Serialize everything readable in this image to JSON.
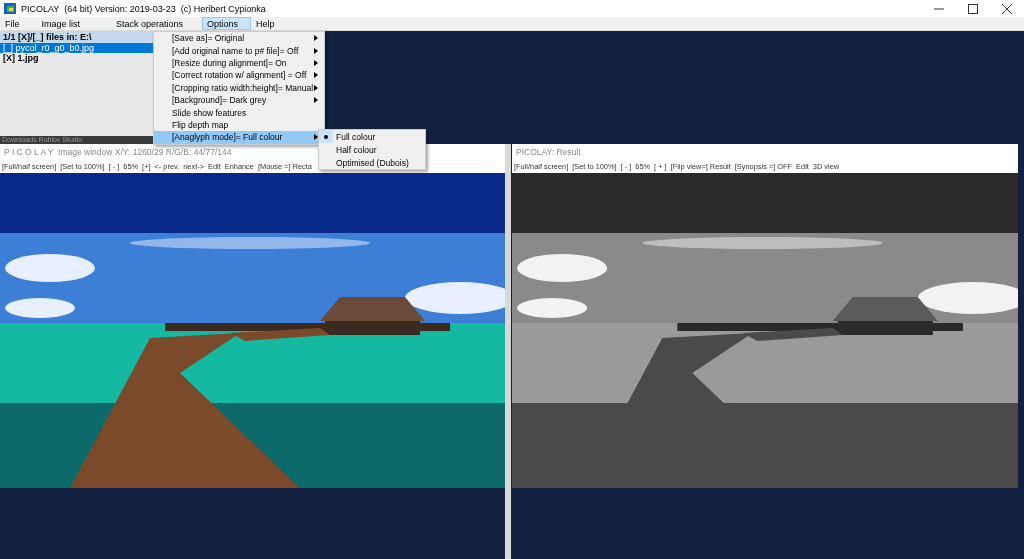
{
  "window": {
    "title": "PICOLAY  (64 bit) Version: 2019-03-23  (c) Heribert Cypionka"
  },
  "menu": [
    {
      "label": "File",
      "selected": false
    },
    {
      "label": "Image list",
      "selected": false
    },
    {
      "label": "Stack operations",
      "selected": false
    },
    {
      "label": "Options",
      "selected": true
    },
    {
      "label": "Help",
      "selected": false
    }
  ],
  "file_list": {
    "header": "1/1 [X]/[_] files in: E:\\",
    "items": [
      {
        "label": "[_] pycol_r0_g0_b0.jpg",
        "selected": true
      },
      {
        "label": "[X] 1.jpg",
        "selected": false
      }
    ]
  },
  "options_menu": {
    "items": [
      {
        "label": "[Save as]= Original",
        "has_submenu": true,
        "selected": false
      },
      {
        "label": "[Add original name to p# file]= Off",
        "has_submenu": true,
        "selected": false
      },
      {
        "label": "[Resize during alignment]= On",
        "has_submenu": true,
        "selected": false
      },
      {
        "label": "[Correct rotation  w/ alignment] = Off",
        "has_submenu": true,
        "selected": false
      },
      {
        "label": "[Cropping ratio width:height]= Manual",
        "has_submenu": true,
        "selected": false
      },
      {
        "label": "[Background]= Dark grey",
        "has_submenu": true,
        "selected": false
      },
      {
        "label": "Slide show features",
        "has_submenu": false,
        "selected": false
      },
      {
        "label": "Flip depth map",
        "has_submenu": false,
        "selected": false
      },
      {
        "label": "[Anaglyph mode]= Full colour",
        "has_submenu": true,
        "selected": true
      }
    ]
  },
  "submenu": {
    "items": [
      {
        "label": "Full colour",
        "checked": true
      },
      {
        "label": "Half colour",
        "checked": false
      },
      {
        "label": "Optimised (Dubois)",
        "checked": false
      }
    ]
  },
  "background_window": {
    "title": "Downloads  Roblox Studio"
  },
  "image_windows": [
    {
      "title": "P I C O L A Y  Image window X/Y: 1260/29 R/G/B: 44/77/144",
      "toolbar": [
        "[Full/half screen]",
        "[Set to 100%]",
        "[ - ]",
        "65%",
        "[+]",
        "<- prev.",
        "next->",
        "Edit",
        "Enhance",
        "[Mouse =] Recta"
      ],
      "picture": {
        "kind": "picture",
        "greyscale": false
      }
    },
    {
      "title": "PICOLAY: Result",
      "toolbar": [
        "[Full/half screen]",
        "[Set to 100%]",
        "[ - ]",
        "65%",
        "[ + ]",
        "[Flip view=] Result",
        "[Synopsis =] OFF",
        "Edit",
        "3D view"
      ],
      "picture": {
        "kind": "picture",
        "greyscale": true
      }
    }
  ]
}
